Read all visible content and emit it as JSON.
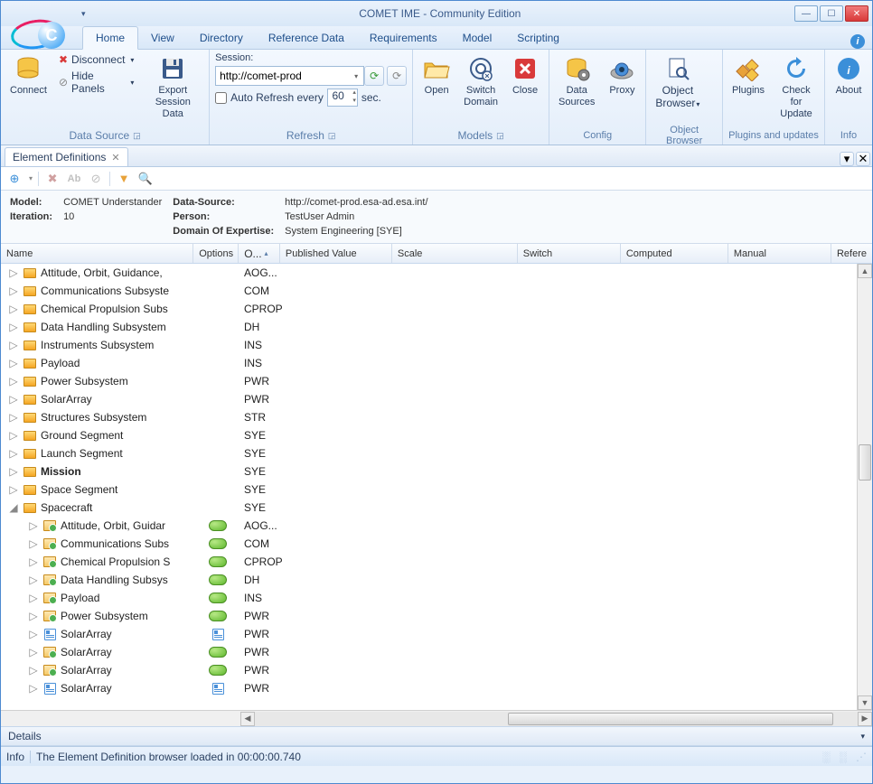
{
  "window": {
    "title": "COMET IME - Community Edition"
  },
  "ribbon": {
    "tabs": [
      "Home",
      "View",
      "Directory",
      "Reference Data",
      "Requirements",
      "Model",
      "Scripting"
    ],
    "active": 0,
    "groups": {
      "datasource": {
        "label": "Data Source",
        "connect": "Connect",
        "disconnect": "Disconnect",
        "hide_panels": "Hide Panels",
        "export": "Export\nSession Data"
      },
      "refresh": {
        "label": "Refresh",
        "session": "Session:",
        "url": "http://comet-prod",
        "auto": "Auto Refresh every",
        "seconds": "60",
        "sec": "sec."
      },
      "models": {
        "label": "Models",
        "open": "Open",
        "switch": "Switch\nDomain",
        "close": "Close"
      },
      "config": {
        "label": "Config",
        "ds": "Data\nSources",
        "proxy": "Proxy"
      },
      "ob": {
        "label": "Object Browser",
        "btn": "Object\nBrowser"
      },
      "plugins": {
        "label": "Plugins and updates",
        "plugins": "Plugins",
        "update": "Check for\nUpdate"
      },
      "info": {
        "label": "Info",
        "about": "About"
      }
    }
  },
  "doc_tab": "Element Definitions",
  "info": {
    "model_k": "Model:",
    "model_v": "COMET Understander",
    "ds_k": "Data-Source:",
    "ds_v": "http://comet-prod.esa-ad.esa.int/",
    "iter_k": "Iteration:",
    "iter_v": "10",
    "person_k": "Person:",
    "person_v": "TestUser Admin",
    "dom_k": "Domain Of Expertise:",
    "dom_v": "System Engineering [SYE]"
  },
  "columns": {
    "name": "Name",
    "options": "Options",
    "code": "O...",
    "pub": "Published Value",
    "scale": "Scale",
    "switch": "Switch",
    "computed": "Computed",
    "manual": "Manual",
    "reference": "Refere"
  },
  "rows": [
    {
      "d": 0,
      "exp": "▷",
      "icon": "folder",
      "name": "Attitude, Orbit, Guidance,",
      "opt": false,
      "code": "AOG..."
    },
    {
      "d": 0,
      "exp": "▷",
      "icon": "folder",
      "name": "Communications Subsyste",
      "opt": false,
      "code": "COM"
    },
    {
      "d": 0,
      "exp": "▷",
      "icon": "folder",
      "name": "Chemical Propulsion Subs",
      "opt": false,
      "code": "CPROP"
    },
    {
      "d": 0,
      "exp": "▷",
      "icon": "folder",
      "name": "Data Handling Subsystem",
      "opt": false,
      "code": "DH"
    },
    {
      "d": 0,
      "exp": "▷",
      "icon": "folder",
      "name": "Instruments Subsystem",
      "opt": false,
      "code": "INS"
    },
    {
      "d": 0,
      "exp": "▷",
      "icon": "folder",
      "name": "Payload",
      "opt": false,
      "code": "INS"
    },
    {
      "d": 0,
      "exp": "▷",
      "icon": "folder",
      "name": "Power Subsystem",
      "opt": false,
      "code": "PWR"
    },
    {
      "d": 0,
      "exp": "▷",
      "icon": "folder",
      "name": "SolarArray",
      "opt": false,
      "code": "PWR"
    },
    {
      "d": 0,
      "exp": "▷",
      "icon": "folder",
      "name": "Structures Subsystem",
      "opt": false,
      "code": "STR"
    },
    {
      "d": 0,
      "exp": "▷",
      "icon": "folder",
      "name": "Ground Segment",
      "opt": false,
      "code": "SYE"
    },
    {
      "d": 0,
      "exp": "▷",
      "icon": "folder",
      "name": "Launch Segment",
      "opt": false,
      "code": "SYE"
    },
    {
      "d": 0,
      "exp": "▷",
      "icon": "folder",
      "name": "Mission",
      "opt": false,
      "code": "SYE",
      "bold": true
    },
    {
      "d": 0,
      "exp": "▷",
      "icon": "folder",
      "name": "Space Segment",
      "opt": false,
      "code": "SYE"
    },
    {
      "d": 0,
      "exp": "◢",
      "icon": "folder",
      "name": "Spacecraft",
      "opt": false,
      "code": "SYE"
    },
    {
      "d": 1,
      "exp": "▷",
      "icon": "usage",
      "name": "Attitude, Orbit, Guidar",
      "opt": true,
      "code": "AOG..."
    },
    {
      "d": 1,
      "exp": "▷",
      "icon": "usage",
      "name": "Communications Subs",
      "opt": true,
      "code": "COM"
    },
    {
      "d": 1,
      "exp": "▷",
      "icon": "usage",
      "name": "Chemical Propulsion S",
      "opt": true,
      "code": "CPROP"
    },
    {
      "d": 1,
      "exp": "▷",
      "icon": "usage",
      "name": "Data Handling Subsys",
      "opt": true,
      "code": "DH"
    },
    {
      "d": 1,
      "exp": "▷",
      "icon": "usage",
      "name": "Payload",
      "opt": true,
      "code": "INS"
    },
    {
      "d": 1,
      "exp": "▷",
      "icon": "usage",
      "name": "Power Subsystem",
      "opt": true,
      "code": "PWR"
    },
    {
      "d": 1,
      "exp": "▷",
      "icon": "prop",
      "name": "SolarArray",
      "opt": false,
      "code": "PWR"
    },
    {
      "d": 1,
      "exp": "▷",
      "icon": "usage",
      "name": "SolarArray",
      "opt": true,
      "code": "PWR"
    },
    {
      "d": 1,
      "exp": "▷",
      "icon": "usage",
      "name": "SolarArray",
      "opt": true,
      "code": "PWR"
    },
    {
      "d": 1,
      "exp": "▷",
      "icon": "prop",
      "name": "SolarArray",
      "opt": false,
      "code": "PWR"
    }
  ],
  "details": "Details",
  "status": {
    "prefix": "Info",
    "msg": "The Element Definition browser loaded in 00:00:00.740"
  }
}
